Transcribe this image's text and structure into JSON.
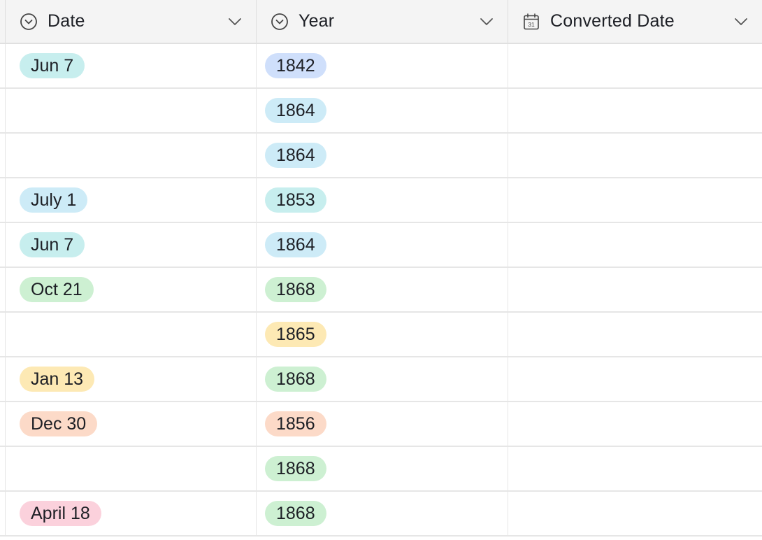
{
  "columns": {
    "date": {
      "label": "Date",
      "icon": "single-select-icon"
    },
    "year": {
      "label": "Year",
      "icon": "single-select-icon"
    },
    "converted": {
      "label": "Converted Date",
      "icon": "calendar-icon",
      "icon_text": "31"
    }
  },
  "colors": {
    "cyan": "#c7eeee",
    "blue": "#cfdffb",
    "sky": "#cdebf7",
    "green": "#cdf0d2",
    "yellow": "#fde9b4",
    "orange": "#fcdac8",
    "pink": "#fbd1dc"
  },
  "rows": [
    {
      "date": "Jun 7",
      "date_color": "cyan",
      "year": "1842",
      "year_color": "blue",
      "converted": ""
    },
    {
      "date": "",
      "date_color": "none",
      "year": "1864",
      "year_color": "sky",
      "converted": ""
    },
    {
      "date": "",
      "date_color": "none",
      "year": "1864",
      "year_color": "sky",
      "converted": ""
    },
    {
      "date": "July 1",
      "date_color": "sky",
      "year": "1853",
      "year_color": "cyan",
      "converted": ""
    },
    {
      "date": "Jun 7",
      "date_color": "cyan",
      "year": "1864",
      "year_color": "sky",
      "converted": ""
    },
    {
      "date": "Oct 21",
      "date_color": "green",
      "year": "1868",
      "year_color": "green",
      "converted": ""
    },
    {
      "date": "",
      "date_color": "none",
      "year": "1865",
      "year_color": "yellow",
      "converted": ""
    },
    {
      "date": "Jan 13",
      "date_color": "yellow",
      "year": "1868",
      "year_color": "green",
      "converted": ""
    },
    {
      "date": "Dec 30",
      "date_color": "orange",
      "year": "1856",
      "year_color": "orange",
      "converted": ""
    },
    {
      "date": "",
      "date_color": "none",
      "year": "1868",
      "year_color": "green",
      "converted": ""
    },
    {
      "date": "April 18",
      "date_color": "pink",
      "year": "1868",
      "year_color": "green",
      "converted": ""
    }
  ]
}
